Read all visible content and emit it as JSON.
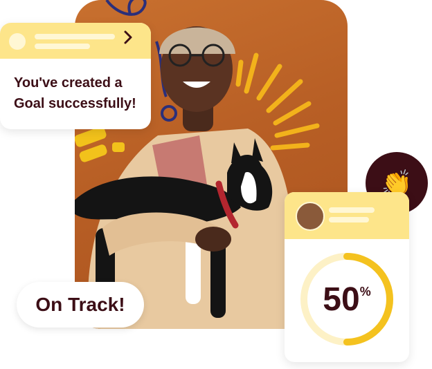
{
  "goal_card": {
    "message": "You've created a Goal successfully!",
    "chevron_icon": "chevron-right-icon"
  },
  "status_pill": {
    "label": "On Track!"
  },
  "progress_card": {
    "value": 50,
    "value_label": "50",
    "unit": "%",
    "ring_color": "#f4c21f",
    "track_color": "#fdf1c6"
  },
  "clap_badge": {
    "icon": "clapping-hands-icon",
    "glyph": "👏"
  },
  "colors": {
    "accent_yellow": "#fde58a",
    "text_dark": "#3c0e16",
    "photo_bg": "#b85f25"
  }
}
